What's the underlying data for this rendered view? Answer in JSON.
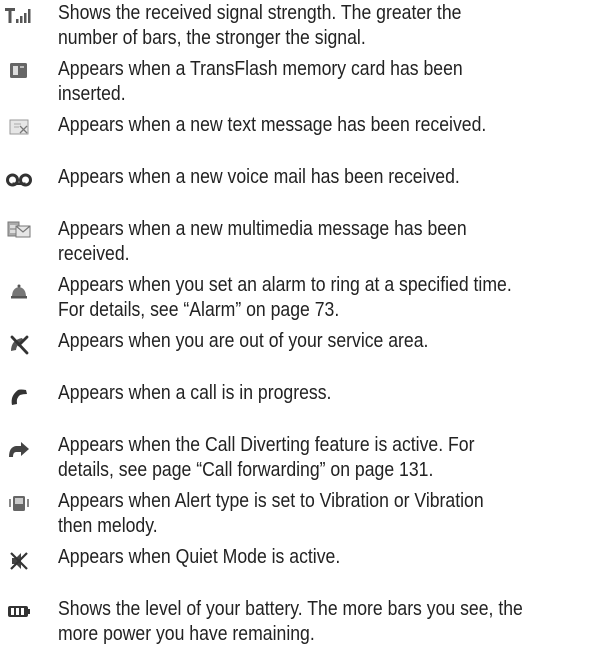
{
  "icon_legend": [
    {
      "icon": "signal-strength-icon",
      "lines": [
        "Shows the received signal strength. The greater the",
        "number of bars, the stronger the signal."
      ]
    },
    {
      "icon": "memory-card-icon",
      "lines": [
        "Appears when a TransFlash memory card has been",
        "inserted."
      ]
    },
    {
      "icon": "text-message-icon",
      "lines": [
        "Appears when a new text message has been received."
      ]
    },
    {
      "icon": "voice-mail-icon",
      "lines": [
        "Appears when a new voice mail has been received."
      ]
    },
    {
      "icon": "multimedia-message-icon",
      "lines": [
        "Appears when a new multimedia message has been",
        "received."
      ]
    },
    {
      "icon": "alarm-icon",
      "lines": [
        "Appears when you set an alarm to ring at a specified time.",
        "For details, see “Alarm” on page 73."
      ]
    },
    {
      "icon": "no-service-icon",
      "lines": [
        "Appears when you are out of your service area."
      ]
    },
    {
      "icon": "call-in-progress-icon",
      "lines": [
        "Appears when a call is in progress."
      ]
    },
    {
      "icon": "call-divert-icon",
      "lines": [
        "Appears when the Call Diverting feature is active. For",
        "details, see page “Call forwarding” on page 131."
      ]
    },
    {
      "icon": "vibration-icon",
      "lines": [
        "Appears when Alert type is set to Vibration or Vibration",
        "then melody."
      ]
    },
    {
      "icon": "quiet-mode-icon",
      "lines": [
        "Appears when Quiet Mode is active."
      ]
    },
    {
      "icon": "battery-icon",
      "lines": [
        "Shows the level of your battery. The more bars you see, the",
        "more power you have remaining."
      ]
    }
  ]
}
